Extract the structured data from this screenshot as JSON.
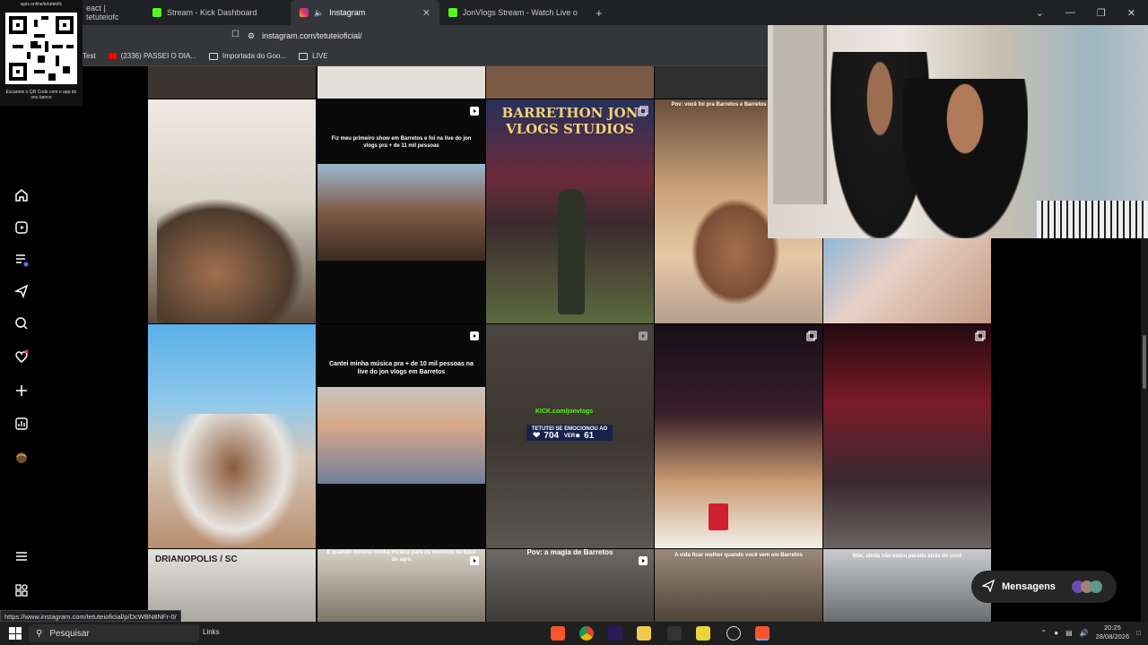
{
  "browser": {
    "tabs": [
      {
        "label": "eact | tetuteiofc",
        "active": false,
        "fav_color": "#53fc18"
      },
      {
        "label": "Stream - Kick Dashboard",
        "active": false,
        "fav_color": "#53fc18"
      },
      {
        "label": "Instagram",
        "active": true,
        "fav_color": "#e1306c"
      },
      {
        "label": "JonVlogs Stream - Watch Live on Kick",
        "active": false,
        "fav_color": "#53fc18"
      }
    ],
    "url": "instagram.com/tetuteioficial/",
    "bookmarks": [
      {
        "label": "Test",
        "icon": "none"
      },
      {
        "label": "(2336) PASSEI O DIA...",
        "icon": "youtube-icon"
      },
      {
        "label": "Importada do Goo...",
        "icon": "folder-icon"
      },
      {
        "label": "LIVE",
        "icon": "folder-icon"
      }
    ]
  },
  "qr_overlay": {
    "top_text": "wpix.online/tetuteiofc",
    "caption": "Escaneie o QR Code com o app do seu banco"
  },
  "instagram": {
    "nav_icons": [
      "home-icon",
      "reels-icon",
      "threads-icon",
      "explore-icon",
      "search-icon",
      "notifications-icon",
      "create-icon",
      "dashboard-icon",
      "profile-icon",
      "more-icon",
      "apps-icon"
    ],
    "posts": [
      {
        "caption": "",
        "bg": "#d9d3c8"
      },
      {
        "caption": "Fiz meu primeiro show em Barretos e foi na live do jon vlogs pra + de 11 mil pessoas",
        "bg": "#0a0a0a"
      },
      {
        "caption": "BARRETHON JON VLOGS STUDIOS",
        "bg": "#3a2a3f"
      },
      {
        "caption": "Pov: você foi pra Barretos e Barretos tem mag... mer",
        "bg": "#c9a27a"
      },
      {
        "caption": "",
        "bg": "#8fb7d6"
      },
      {
        "caption": "Cantei minha música pra + de 10 mil pessoas na live do jon vlogs em Barretos",
        "bg": "#0a0a0a"
      },
      {
        "caption": "TETUTEI SE EMOCIONOU AO VER",
        "bg": "#3b3630"
      },
      {
        "caption": "",
        "bg": "#201a1d"
      },
      {
        "caption": "",
        "bg": "#2b1520"
      },
      {
        "caption": "DRIANOPOLIS / SC",
        "bg": "#c3c1b8"
      },
      {
        "caption": "E quando mostrei minha música para os meninos da base do agro",
        "bg": "#7c7466"
      },
      {
        "caption": "Pov: a magia de Barretos",
        "bg": "#4e4a45"
      },
      {
        "caption": "A vida ficar melhor quando você vem em Barretos",
        "bg": "#6b5f50"
      },
      {
        "caption": "Mãe, ainda não estou parada atrás de você",
        "bg": "#99a0a6"
      }
    ],
    "overlay_site": "KICK.com/jonvlogs",
    "overlay_likes": "704",
    "overlay_comments": "61",
    "messages_label": "Mensagens"
  },
  "status_url": "https://www.instagram.com/tetuteioficial/p/DcWBN8NFr-0/",
  "taskbar": {
    "search_placeholder": "Pesquisar",
    "links_label": "Links",
    "time": "20:25",
    "date": "28/08/2026"
  }
}
